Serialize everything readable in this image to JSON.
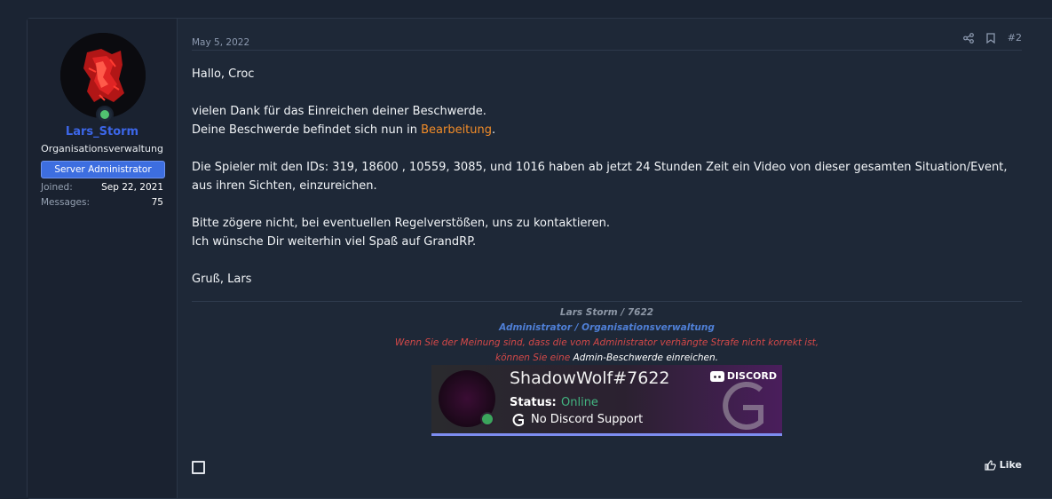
{
  "user": {
    "username": "Lars_Storm",
    "title": "Organisationsverwaltung",
    "banner": "Server Administrator",
    "stats": [
      {
        "key": "Joined:",
        "value": "Sep 22, 2021"
      },
      {
        "key": "Messages:",
        "value": "75"
      }
    ]
  },
  "post": {
    "date": "May 5, 2022",
    "number": "#2",
    "greeting": "Hallo, Croc",
    "p2a": "vielen Dank für das Einreichen deiner Beschwerde.",
    "p2b_pre": "Deine Beschwerde befindet sich nun in ",
    "p2b_hl": "Bearbeitung",
    "p2b_post": ".",
    "p3": "Die Spieler mit den IDs: 319, 18600 , 10559, 3085, und 1016 haben ab jetzt 24 Stunden Zeit ein Video von dieser gesamten Situation/Event, aus ihren Sichten, einzureichen.",
    "p4a": "Bitte zögere nicht, bei eventuellen Regelverstößen, uns zu kontaktieren.",
    "p4b": "Ich wünsche Dir weiterhin viel Spaß auf GrandRP.",
    "closing": "Gruß, Lars",
    "like_label": "Like"
  },
  "signature": {
    "line1": "Lars Storm / 7622",
    "line2": "Administrator / Organisationsverwaltung",
    "line3": "Wenn Sie der Meinung sind, dass die vom Administrator verhängte Strafe nicht korrekt ist,",
    "line4_pre": "können Sie eine ",
    "line4_link": "Admin-Beschwerde einreichen."
  },
  "discord_widget": {
    "tag": "ShadowWolf#7622",
    "logo_label": "DISCORD",
    "status_label": "Status:",
    "status_value": "Online",
    "note": "No Discord Support"
  },
  "colors": {
    "accent": "#3c66e8",
    "highlight": "#f28c28",
    "online": "#43b581"
  }
}
